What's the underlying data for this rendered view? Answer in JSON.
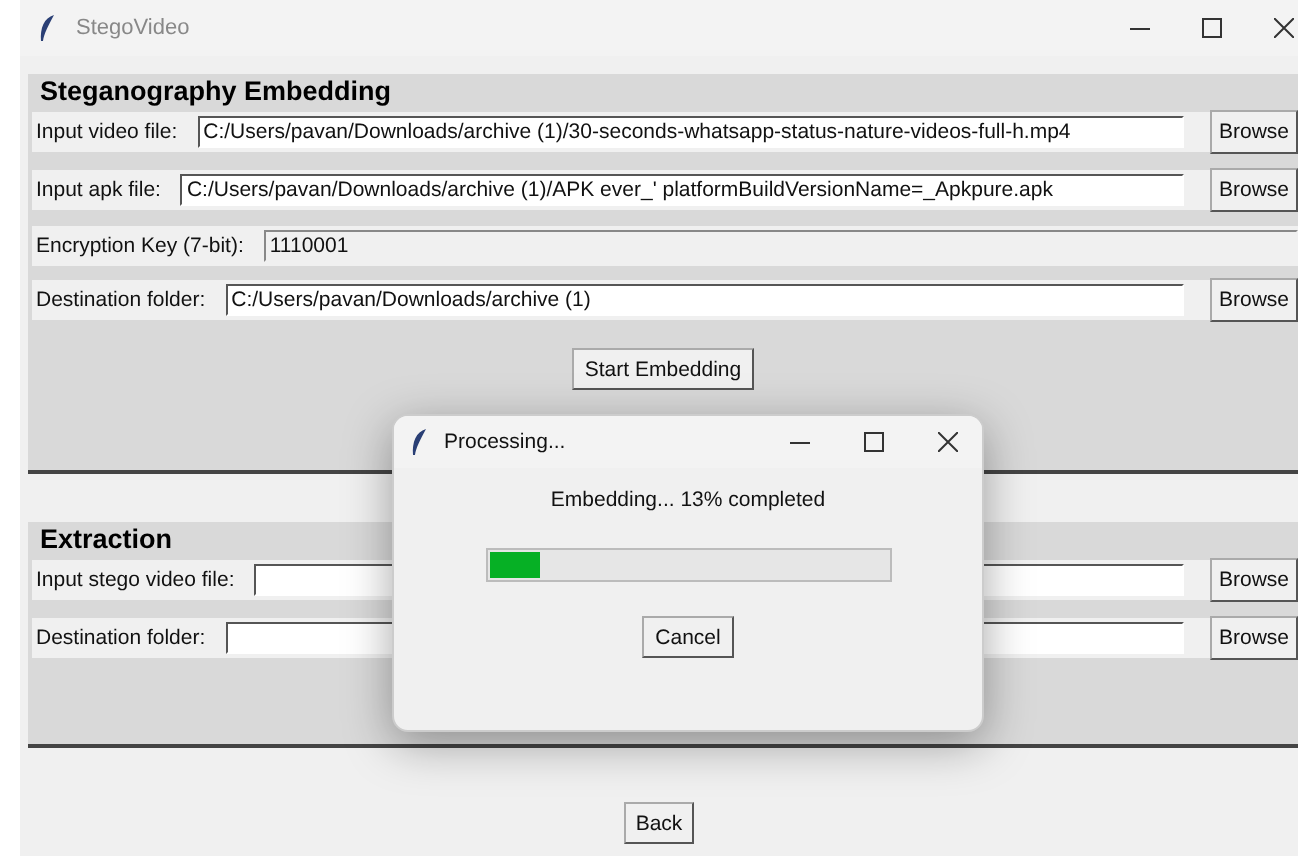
{
  "window": {
    "title": "StegoVideo"
  },
  "embedding": {
    "title": "Steganography Embedding",
    "fields": [
      {
        "kind": "file",
        "label": "Input video file:",
        "value": "C:/Users/pavan/Downloads/archive (1)/30-seconds-whatsapp-status-nature-videos-full-h.mp4",
        "button": "Browse"
      },
      {
        "kind": "file",
        "label": "Input apk file:",
        "value": "C:/Users/pavan/Downloads/archive (1)/APK ever_' platformBuildVersionName=_Apkpure.apk",
        "button": "Browse"
      },
      {
        "kind": "key",
        "label": "Encryption Key (7-bit):",
        "value": "1110001"
      },
      {
        "kind": "file",
        "label": "Destination folder:",
        "value": "C:/Users/pavan/Downloads/archive (1)",
        "button": "Browse"
      }
    ],
    "button": "Start Embedding"
  },
  "extraction": {
    "title": "Extraction",
    "fields": [
      {
        "kind": "file",
        "label": "Input stego video file:",
        "button": "Browse"
      },
      {
        "kind": "file",
        "label": "Destination folder:",
        "button": "Browse"
      }
    ]
  },
  "back_button": "Back",
  "dialog": {
    "title": "Processing...",
    "message": "Embedding... 13% completed",
    "progress": {
      "level": 0.13
    },
    "button": "Cancel"
  }
}
